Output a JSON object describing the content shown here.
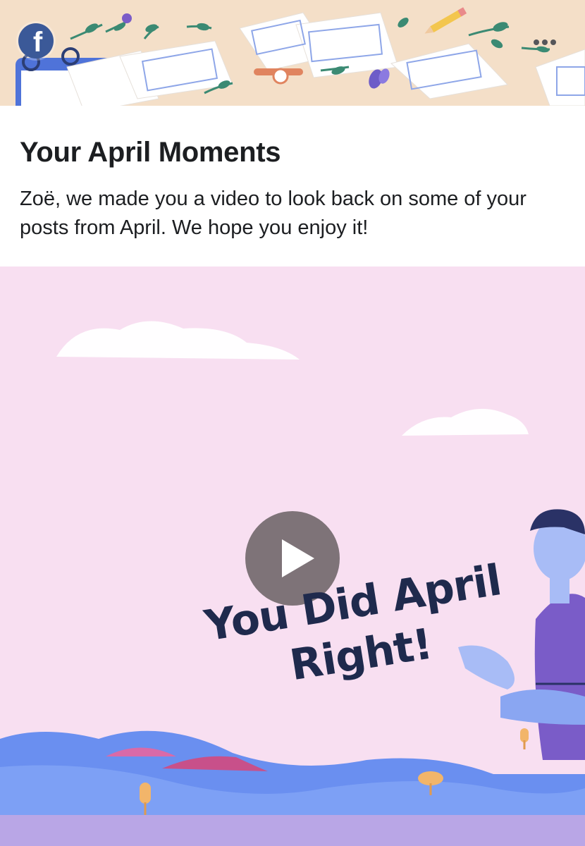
{
  "banner": {
    "logo_letter": "f",
    "logo_icon": "facebook-logo-icon",
    "more_icon": "more-options-icon",
    "bg_color": "#f4dfc8"
  },
  "card": {
    "title": "Your April Moments",
    "description": "Zoë, we made you a video to look back on some of your posts from April. We hope you enjoy it!"
  },
  "video": {
    "caption": "You Did April Right!",
    "play_icon": "play-icon",
    "bg_color": "#f8dff1"
  },
  "colors": {
    "brand": "#3b5998",
    "text": "#1c1e21"
  }
}
